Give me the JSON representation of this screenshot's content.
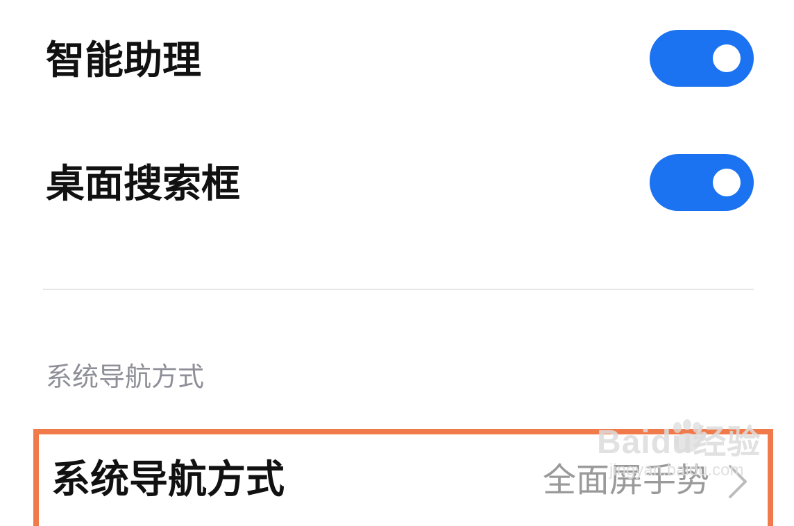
{
  "settings": {
    "items": [
      {
        "label": "智能助理",
        "toggle_state": "on"
      },
      {
        "label": "桌面搜索框",
        "toggle_state": "on"
      }
    ],
    "section_header": "系统导航方式",
    "navigation": {
      "label": "系统导航方式",
      "value": "全面屏手势"
    }
  },
  "watermark": {
    "main_text": "Baidu经验",
    "sub_text": "jingyan.baidu.com"
  },
  "colors": {
    "toggle_on": "#1b73f2",
    "highlight_border": "#f17a4a",
    "secondary_text": "#9a9a9a",
    "section_text": "#8f8f99",
    "divider": "#e6e6e6"
  },
  "icons": {
    "toggle_knob": "toggle-knob",
    "chevron": "chevron-right-icon"
  }
}
